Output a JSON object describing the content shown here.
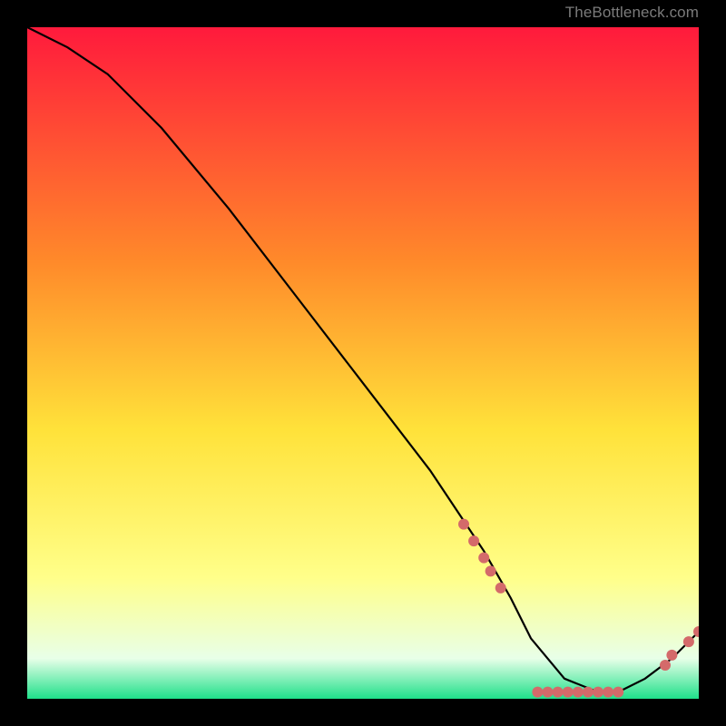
{
  "watermark": "TheBottleneck.com",
  "colors": {
    "gradient_top": "#ff1a3c",
    "gradient_mid1": "#ff8a2a",
    "gradient_mid2": "#ffe23a",
    "gradient_mid3": "#ffff8a",
    "gradient_near_bottom": "#e8ffe8",
    "gradient_bottom": "#1fe08a",
    "line": "#000000",
    "marker": "#d46a6a"
  },
  "chart_data": {
    "type": "line",
    "title": "",
    "xlabel": "",
    "ylabel": "",
    "xlim": [
      0,
      100
    ],
    "ylim": [
      0,
      100
    ],
    "series": [
      {
        "name": "curve",
        "x": [
          0,
          6,
          12,
          20,
          30,
          40,
          50,
          60,
          68,
          72,
          75,
          80,
          85,
          88,
          92,
          96,
          100
        ],
        "y": [
          100,
          97,
          93,
          85,
          73,
          60,
          47,
          34,
          22,
          15,
          9,
          3,
          1,
          1,
          3,
          6,
          10
        ]
      }
    ],
    "markers": [
      {
        "x": 65.0,
        "y": 26.0
      },
      {
        "x": 66.5,
        "y": 23.5
      },
      {
        "x": 68.0,
        "y": 21.0
      },
      {
        "x": 69.0,
        "y": 19.0
      },
      {
        "x": 70.5,
        "y": 16.5
      },
      {
        "x": 76.0,
        "y": 1.0
      },
      {
        "x": 77.5,
        "y": 1.0
      },
      {
        "x": 79.0,
        "y": 1.0
      },
      {
        "x": 80.5,
        "y": 1.0
      },
      {
        "x": 82.0,
        "y": 1.0
      },
      {
        "x": 83.5,
        "y": 1.0
      },
      {
        "x": 85.0,
        "y": 1.0
      },
      {
        "x": 86.5,
        "y": 1.0
      },
      {
        "x": 88.0,
        "y": 1.0
      },
      {
        "x": 95.0,
        "y": 5.0
      },
      {
        "x": 96.0,
        "y": 6.5
      },
      {
        "x": 98.5,
        "y": 8.5
      },
      {
        "x": 100.0,
        "y": 10.0
      }
    ]
  }
}
